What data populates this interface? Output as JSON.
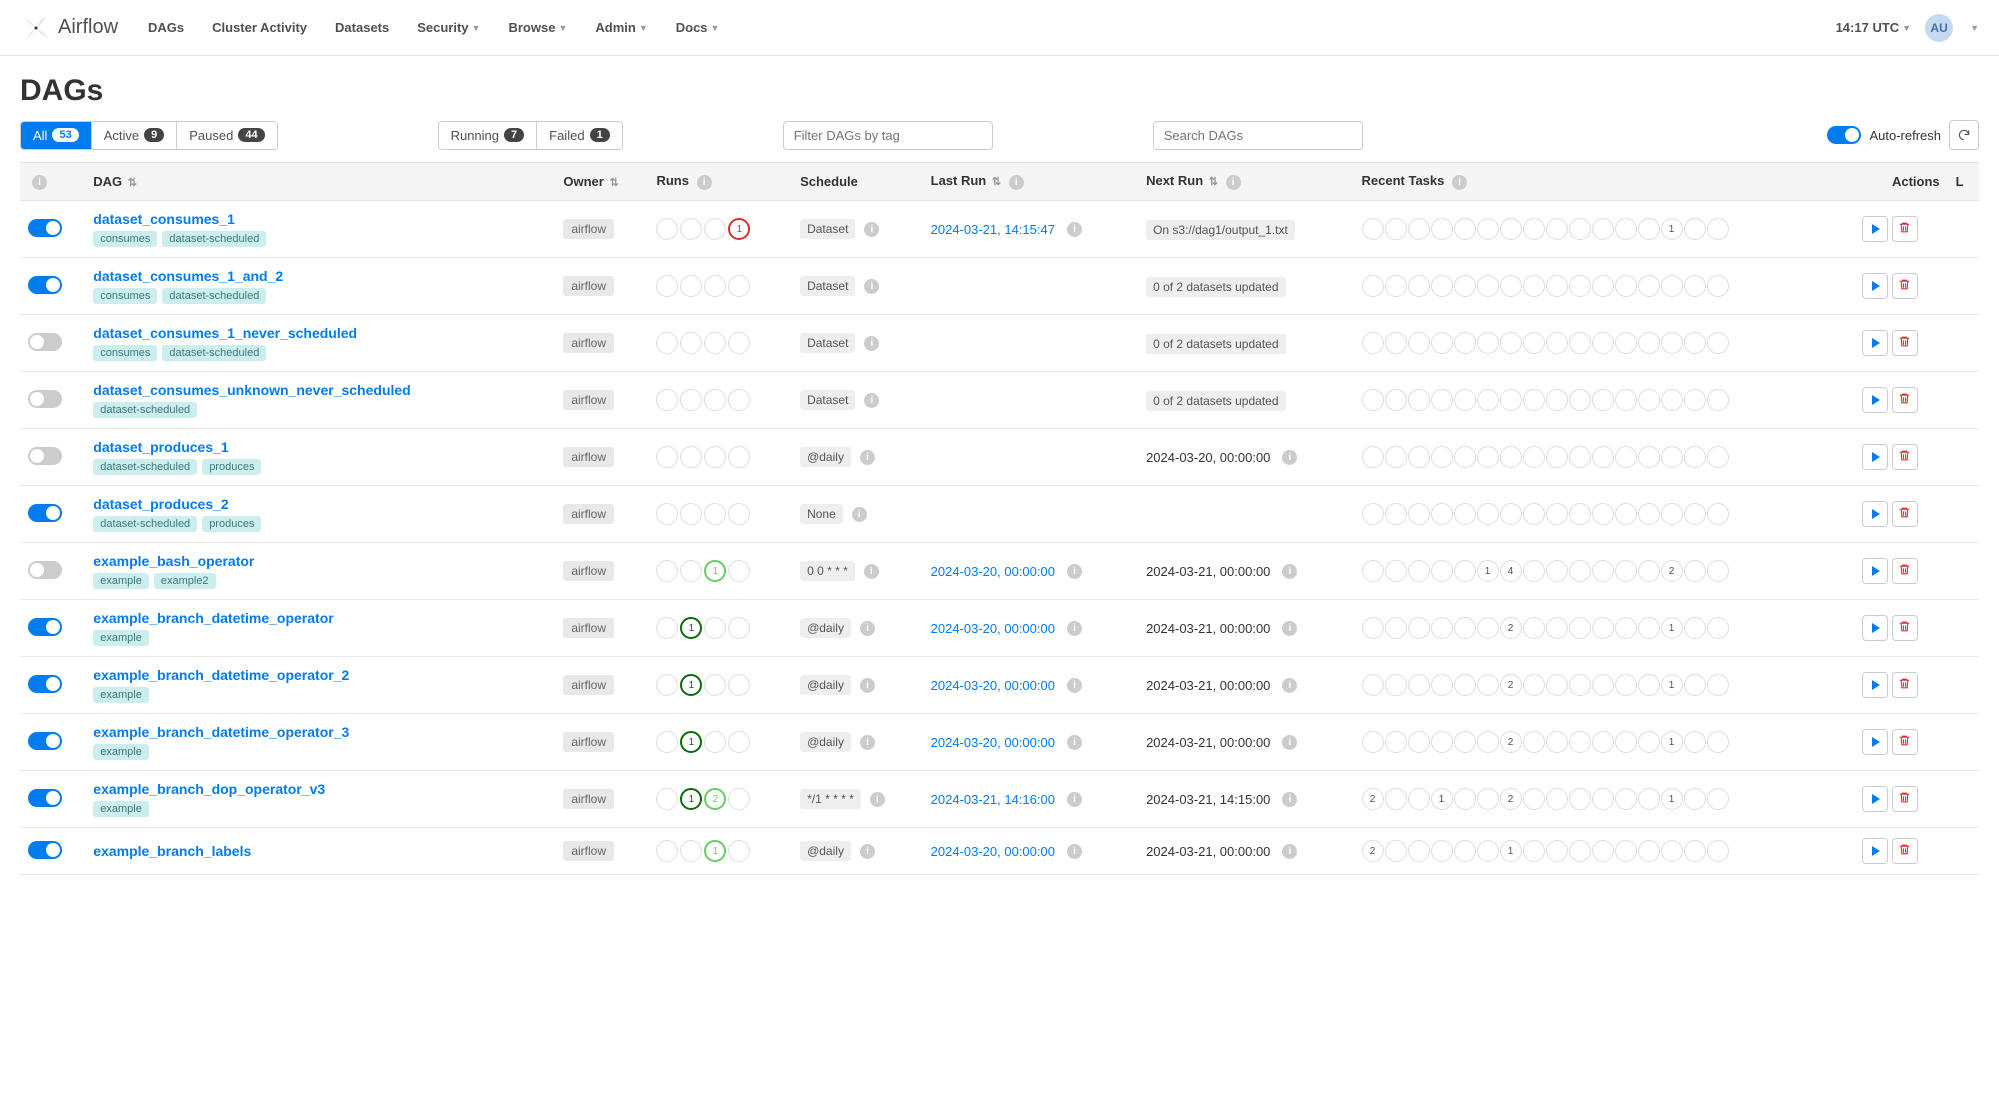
{
  "nav": {
    "brand": "Airflow",
    "items": [
      "DAGs",
      "Cluster Activity",
      "Datasets",
      "Security",
      "Browse",
      "Admin",
      "Docs"
    ],
    "dropdowns": [
      false,
      false,
      false,
      true,
      true,
      true,
      true
    ],
    "time": "14:17 UTC",
    "user": "AU"
  },
  "page": {
    "title": "DAGs"
  },
  "filters_state": {
    "all": {
      "label": "All",
      "count": "53"
    },
    "active": {
      "label": "Active",
      "count": "9"
    },
    "paused": {
      "label": "Paused",
      "count": "44"
    }
  },
  "filters_run": {
    "running": {
      "label": "Running",
      "count": "7"
    },
    "failed": {
      "label": "Failed",
      "count": "1"
    }
  },
  "inputs": {
    "filter_placeholder": "Filter DAGs by tag",
    "search_placeholder": "Search DAGs"
  },
  "auto_refresh": "Auto-refresh",
  "columns": {
    "dag": "DAG",
    "owner": "Owner",
    "runs": "Runs",
    "schedule": "Schedule",
    "last_run": "Last Run",
    "next_run": "Next Run",
    "recent_tasks": "Recent Tasks",
    "actions": "Actions",
    "l": "L"
  },
  "dags": [
    {
      "on": true,
      "name": "dataset_consumes_1",
      "tags": [
        "consumes",
        "dataset-scheduled"
      ],
      "owner": "airflow",
      "runs": [
        {
          "cls": "",
          "v": ""
        },
        {
          "cls": "",
          "v": ""
        },
        {
          "cls": "",
          "v": ""
        },
        {
          "cls": "red",
          "v": "1"
        }
      ],
      "schedule": "Dataset",
      "last_run": "2024-03-21, 14:15:47",
      "next_run": "On s3://dag1/output_1.txt",
      "next_run_badge": true,
      "tasks": [
        {
          "p": 0,
          "cls": "",
          "v": ""
        },
        {
          "p": 13,
          "cls": "pink",
          "v": "1"
        }
      ]
    },
    {
      "on": true,
      "name": "dataset_consumes_1_and_2",
      "tags": [
        "consumes",
        "dataset-scheduled"
      ],
      "owner": "airflow",
      "runs": [],
      "schedule": "Dataset",
      "last_run": "",
      "next_run": "0 of 2 datasets updated",
      "next_run_badge": true,
      "tasks": []
    },
    {
      "on": false,
      "name": "dataset_consumes_1_never_scheduled",
      "tags": [
        "consumes",
        "dataset-scheduled"
      ],
      "owner": "airflow",
      "runs": [],
      "schedule": "Dataset",
      "last_run": "",
      "next_run": "0 of 2 datasets updated",
      "next_run_badge": true,
      "tasks": []
    },
    {
      "on": false,
      "name": "dataset_consumes_unknown_never_scheduled",
      "tags": [
        "dataset-scheduled"
      ],
      "owner": "airflow",
      "runs": [],
      "schedule": "Dataset",
      "last_run": "",
      "next_run": "0 of 2 datasets updated",
      "next_run_badge": true,
      "tasks": []
    },
    {
      "on": false,
      "name": "dataset_produces_1",
      "tags": [
        "dataset-scheduled",
        "produces"
      ],
      "owner": "airflow",
      "runs": [],
      "schedule": "@daily",
      "last_run": "",
      "next_run": "2024-03-20, 00:00:00",
      "next_run_badge": false,
      "tasks": []
    },
    {
      "on": true,
      "name": "dataset_produces_2",
      "tags": [
        "dataset-scheduled",
        "produces"
      ],
      "owner": "airflow",
      "runs": [],
      "schedule": "None",
      "last_run": "",
      "next_run": "",
      "next_run_badge": false,
      "tasks": []
    },
    {
      "on": false,
      "name": "example_bash_operator",
      "tags": [
        "example",
        "example2"
      ],
      "owner": "airflow",
      "runs": [
        {
          "cls": "",
          "v": ""
        },
        {
          "cls": "",
          "v": ""
        },
        {
          "cls": "green-light",
          "v": "1"
        },
        {
          "cls": "",
          "v": ""
        }
      ],
      "schedule": "0 0 * * *",
      "last_run": "2024-03-20, 00:00:00",
      "next_run": "2024-03-21, 00:00:00",
      "next_run_badge": false,
      "tasks": [
        {
          "p": 5,
          "cls": "green-light",
          "v": "1"
        },
        {
          "p": 6,
          "cls": "dkgreen",
          "v": "4"
        },
        {
          "p": 13,
          "cls": "pink",
          "v": "2"
        }
      ]
    },
    {
      "on": true,
      "name": "example_branch_datetime_operator",
      "tags": [
        "example"
      ],
      "owner": "airflow",
      "runs": [
        {
          "cls": "",
          "v": ""
        },
        {
          "cls": "dkgreen",
          "v": "1"
        },
        {
          "cls": "",
          "v": ""
        },
        {
          "cls": "",
          "v": ""
        }
      ],
      "schedule": "@daily",
      "last_run": "2024-03-20, 00:00:00",
      "next_run": "2024-03-21, 00:00:00",
      "next_run_badge": false,
      "tasks": [
        {
          "p": 6,
          "cls": "dkgreen",
          "v": "2"
        },
        {
          "p": 13,
          "cls": "pink",
          "v": "1"
        }
      ]
    },
    {
      "on": true,
      "name": "example_branch_datetime_operator_2",
      "tags": [
        "example"
      ],
      "owner": "airflow",
      "runs": [
        {
          "cls": "",
          "v": ""
        },
        {
          "cls": "dkgreen",
          "v": "1"
        },
        {
          "cls": "",
          "v": ""
        },
        {
          "cls": "",
          "v": ""
        }
      ],
      "schedule": "@daily",
      "last_run": "2024-03-20, 00:00:00",
      "next_run": "2024-03-21, 00:00:00",
      "next_run_badge": false,
      "tasks": [
        {
          "p": 6,
          "cls": "dkgreen",
          "v": "2"
        },
        {
          "p": 13,
          "cls": "pink",
          "v": "1"
        }
      ]
    },
    {
      "on": true,
      "name": "example_branch_datetime_operator_3",
      "tags": [
        "example"
      ],
      "owner": "airflow",
      "runs": [
        {
          "cls": "",
          "v": ""
        },
        {
          "cls": "dkgreen",
          "v": "1"
        },
        {
          "cls": "",
          "v": ""
        },
        {
          "cls": "",
          "v": ""
        }
      ],
      "schedule": "@daily",
      "last_run": "2024-03-20, 00:00:00",
      "next_run": "2024-03-21, 00:00:00",
      "next_run_badge": false,
      "tasks": [
        {
          "p": 6,
          "cls": "dkgreen",
          "v": "2"
        },
        {
          "p": 13,
          "cls": "pink",
          "v": "1"
        }
      ]
    },
    {
      "on": true,
      "name": "example_branch_dop_operator_v3",
      "tags": [
        "example"
      ],
      "owner": "airflow",
      "runs": [
        {
          "cls": "",
          "v": ""
        },
        {
          "cls": "dkgreen",
          "v": "1"
        },
        {
          "cls": "green-light",
          "v": "2"
        },
        {
          "cls": "",
          "v": ""
        }
      ],
      "schedule": "*/1 * * * *",
      "last_run": "2024-03-21, 14:16:00",
      "next_run": "2024-03-21, 14:15:00",
      "next_run_badge": false,
      "tasks": [
        {
          "p": 0,
          "cls": "teal",
          "v": "2"
        },
        {
          "p": 3,
          "cls": "grey",
          "v": "1"
        },
        {
          "p": 6,
          "cls": "dkgreen",
          "v": "2"
        },
        {
          "p": 13,
          "cls": "pink",
          "v": "1"
        }
      ]
    },
    {
      "on": true,
      "name": "example_branch_labels",
      "tags": [],
      "owner": "airflow",
      "runs": [
        {
          "cls": "",
          "v": ""
        },
        {
          "cls": "",
          "v": ""
        },
        {
          "cls": "green-light",
          "v": "1"
        },
        {
          "cls": "",
          "v": ""
        }
      ],
      "schedule": "@daily",
      "last_run": "2024-03-20, 00:00:00",
      "next_run": "2024-03-21, 00:00:00",
      "next_run_badge": false,
      "tasks": [
        {
          "p": 0,
          "cls": "teal",
          "v": "2"
        },
        {
          "p": 6,
          "cls": "dkgreen",
          "v": "1"
        }
      ]
    }
  ]
}
